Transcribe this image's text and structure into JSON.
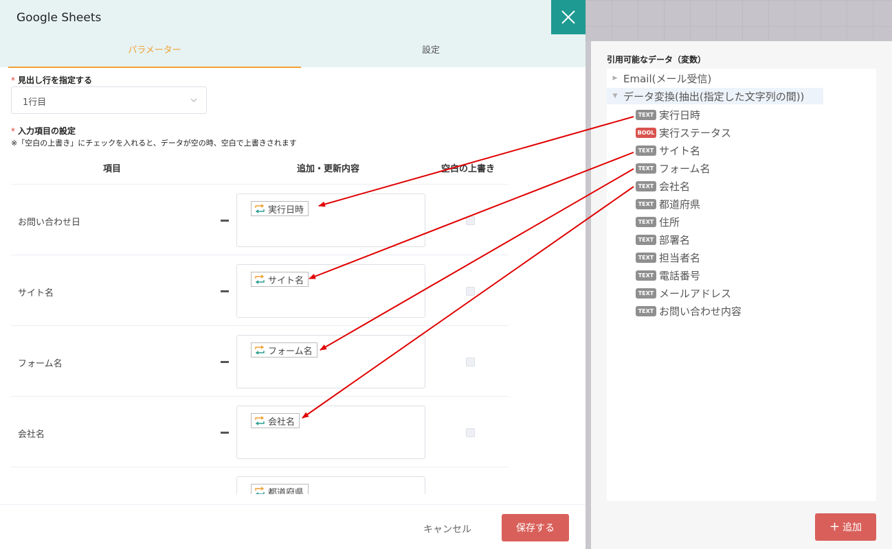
{
  "modal": {
    "title": "Google Sheets",
    "close_icon": "close-icon",
    "tabs": [
      {
        "label": "パラメーター",
        "active": true
      },
      {
        "label": "設定",
        "active": false
      }
    ]
  },
  "header_row": {
    "label": "見出し行を指定する",
    "required": true,
    "selected_value": "1行目"
  },
  "input_items": {
    "label": "入力項目の設定",
    "required": true,
    "note": "※「空白の上書き」にチェックを入れると、データが空の時、空白で上書きされます",
    "columns": [
      "項目",
      "追加・更新内容",
      "空白の上書き"
    ],
    "rows": [
      {
        "name": "お問い合わせ日",
        "value": "実行日時",
        "overwrite_blank": false
      },
      {
        "name": "サイト名",
        "value": "サイト名",
        "overwrite_blank": false
      },
      {
        "name": "フォーム名",
        "value": "フォーム名",
        "overwrite_blank": false
      },
      {
        "name": "会社名",
        "value": "会社名",
        "overwrite_blank": false
      },
      {
        "name": "",
        "value": "都道府県",
        "overwrite_blank": false
      }
    ]
  },
  "footer": {
    "cancel_label": "キャンセル",
    "save_label": "保存する"
  },
  "variables_panel": {
    "title": "引用可能なデータ（変数）",
    "nodes": [
      {
        "label": "Email(メール受信)",
        "expanded": false
      },
      {
        "label": "データ変換(抽出(指定した文字列の間))",
        "expanded": true
      }
    ],
    "items": [
      {
        "type": "TEXT",
        "label": "実行日時"
      },
      {
        "type": "BOOL",
        "label": "実行ステータス"
      },
      {
        "type": "TEXT",
        "label": "サイト名"
      },
      {
        "type": "TEXT",
        "label": "フォーム名"
      },
      {
        "type": "TEXT",
        "label": "会社名"
      },
      {
        "type": "TEXT",
        "label": "都道府県"
      },
      {
        "type": "TEXT",
        "label": "住所"
      },
      {
        "type": "TEXT",
        "label": "部署名"
      },
      {
        "type": "TEXT",
        "label": "担当者名"
      },
      {
        "type": "TEXT",
        "label": "電話番号"
      },
      {
        "type": "TEXT",
        "label": "メールアドレス"
      },
      {
        "type": "TEXT",
        "label": "お問い合わせ内容"
      }
    ],
    "add_label": "追加"
  },
  "colors": {
    "accent_orange": "#f0a032",
    "header_teal": "#1e9a92",
    "primary_red": "#d9605a",
    "arrow_red": "#e00000",
    "badge_text": "#8f8f8f",
    "badge_bool": "#d9534f"
  }
}
